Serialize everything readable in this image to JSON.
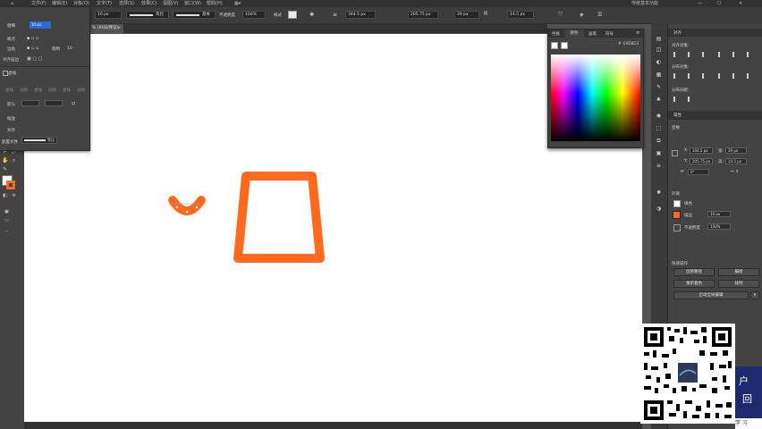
{
  "menubar": {
    "items": [
      "文件(F)",
      "编辑(E)",
      "对象(O)",
      "文字(T)",
      "选择(S)",
      "效果(C)",
      "视图(V)",
      "窗口(W)",
      "帮助(H)"
    ],
    "workspace": "传统基本功能"
  },
  "control_bar": {
    "stroke_label": "描边",
    "stroke_weight": "10 px",
    "stroke_profile": "等比",
    "brush": "基本",
    "opacity_label": "不透明度",
    "opacity_value": "100%",
    "style_label": "样式",
    "x_value": "344.5 px",
    "y_value": "205.75 px",
    "w_value": "29 px",
    "h_value": "14.5 px"
  },
  "document_tab": {
    "label": "% (RGB/预览)",
    "close_glyph": "×"
  },
  "left_panel": {
    "row1_label": "粗细",
    "row1_value": "10 px",
    "row2_label": "端点",
    "row3_label": "边角",
    "row3_extra": "限制",
    "row3_value": "10",
    "row4_label": "对齐描边",
    "checkbox_label": "虚线",
    "dash_labels": [
      "虚线",
      "间隙",
      "虚线",
      "间隙",
      "虚线",
      "间隙"
    ],
    "arrow_label": "箭头",
    "scale_label": "缩放",
    "align_label": "对齐",
    "profile_label": "配置文件",
    "profile_value": "等比"
  },
  "color_panel": {
    "tabs": [
      "色板",
      "颜色",
      "画笔",
      "符号"
    ],
    "hex_label": "#",
    "hex_value": "E95823"
  },
  "right_panel": {
    "title": "对齐",
    "align_objects_label": "对齐对象:",
    "distribute_objects_label": "分布对象:",
    "distribute_spacing_label": "分布间距:",
    "properties_tab": "属性",
    "transform_label": "变换",
    "x_label": "X:",
    "x_value": "344.5 px",
    "w_label": "宽:",
    "w_value": "29 px",
    "y_label": "Y:",
    "y_value": "205.75 px",
    "h_label": "高:",
    "h_value": "14.5 px",
    "rotate_value": "0°",
    "appearance_label": "外观",
    "fill_label": "填色",
    "stroke_label": "描边",
    "stroke_value": "10 px",
    "opacity_label": "不透明度",
    "opacity_value": "100%",
    "quick_actions_label": "快速操作",
    "buttons": [
      "位移路径",
      "编组",
      "重新着色",
      "排列",
      "启动全局编辑"
    ]
  },
  "ad": {
    "lines": [
      "户",
      "回",
      "学 习"
    ]
  },
  "colors": {
    "accent_orange": "#FF6A1F",
    "app_background": "#535353",
    "panel": "#434343",
    "canvas": "#FFFFFF"
  }
}
